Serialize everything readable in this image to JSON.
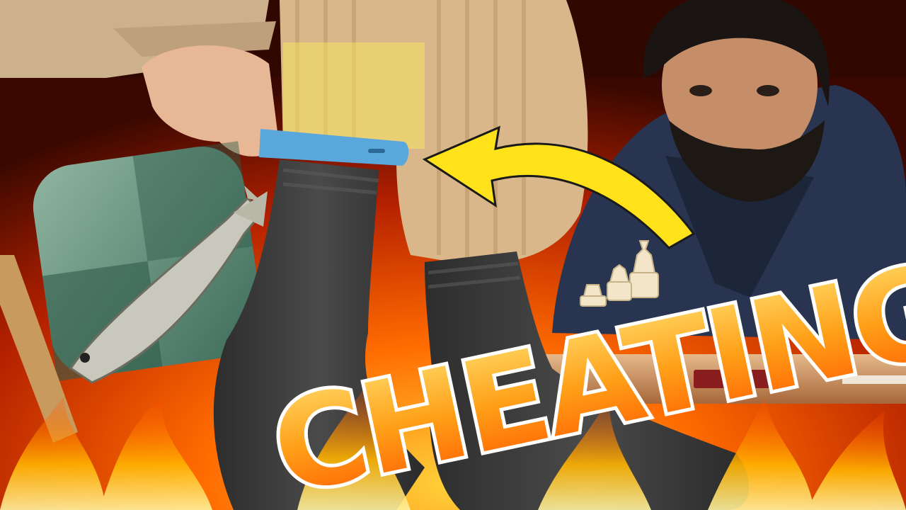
{
  "thumbnail": {
    "headline": "CHEATING!"
  },
  "colors": {
    "fire_core": "#ffb400",
    "fire_mid": "#ff5a00",
    "fire_dark": "#8a1600",
    "background_dark": "#2a0a00",
    "arrow_yellow": "#ffe21a",
    "phone_blue": "#5aa7dc",
    "sock_gray": "#3f3f3f",
    "trouser_tan": "#d9b78a",
    "sweater_beige": "#cdb08c",
    "jacket_navy": "#283450",
    "text_orange_top": "#ffd23a",
    "text_orange_bottom": "#ff6a00"
  },
  "objects": {
    "arrow": "yellow-arrow-icon",
    "fish": "fish-icon",
    "app_icon": "chess-app-icon",
    "phone": "smartphone-icon",
    "chess_pieces": "chess-pieces-icon"
  }
}
